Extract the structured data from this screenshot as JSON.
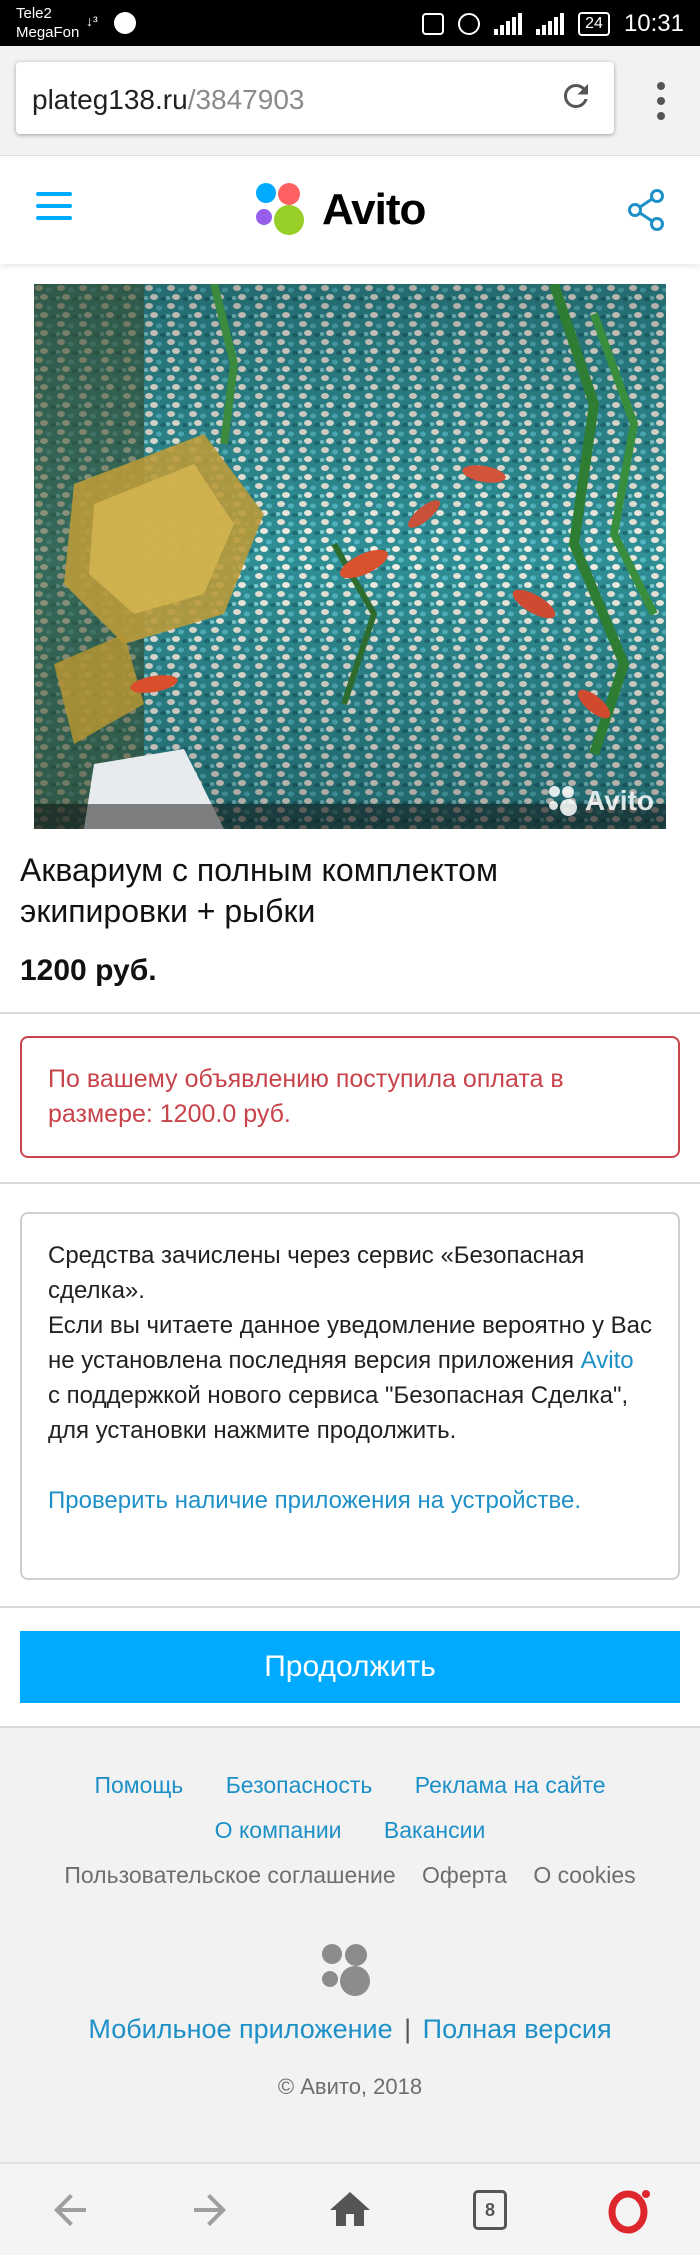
{
  "status_bar": {
    "carrier1": "Tele2",
    "carrier2": "MegaFon",
    "network": "↓³",
    "battery": "24",
    "time": "10:31"
  },
  "browser": {
    "url_domain": "plateg138.ru",
    "url_path": "/3847903",
    "tabs_count": "8"
  },
  "header": {
    "logo_text": "Avito",
    "logo_colors": [
      "#00aaff",
      "#ff6163",
      "#965eeb",
      "#97cf26"
    ]
  },
  "listing": {
    "watermark": "Avito",
    "title": "Аквариум с полным комплектом экипировки + рыбки",
    "price": "1200 руб."
  },
  "alert": {
    "text": "По вашему объявлению поступила оплата в размере: 1200.0 руб."
  },
  "info": {
    "line1": "Средства зачислены через сервис «Безопасная сделка».",
    "line2_before": "Если вы читаете данное уведомление вероятно у Вас не установлена последняя версия приложения ",
    "line2_link": "Avito",
    "line2_after": " с поддержкой нового сервиса \"Безопасная Сделка\", для установки нажмите продолжить.",
    "check_link": "Проверить наличие приложения на устройстве."
  },
  "continue_button": "Продолжить",
  "footer": {
    "links_row1": [
      "Помощь",
      "Безопасность",
      "Реклама на сайте"
    ],
    "links_row2": [
      "О компании",
      "Вакансии"
    ],
    "links_row3": [
      "Пользовательское соглашение",
      "Оферта",
      "О cookies"
    ],
    "mobile_app": "Мобильное приложение",
    "separator": "|",
    "full_version": "Полная версия",
    "copyright": "© Авито, 2018"
  },
  "colors": {
    "accent": "#00aaff",
    "link": "#1e90c8",
    "alert": "#c8434a"
  }
}
